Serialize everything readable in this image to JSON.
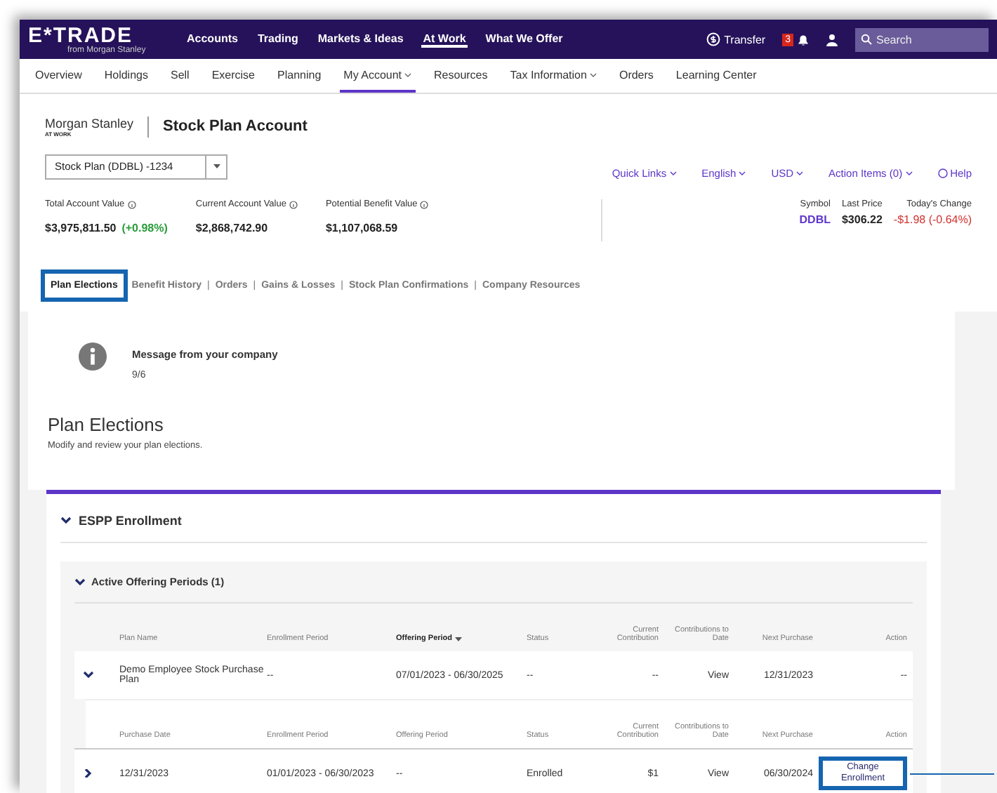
{
  "brand": {
    "logo": "E*TRADE",
    "tagline": "from Morgan Stanley"
  },
  "top_nav": [
    {
      "label": "Accounts",
      "selected": false
    },
    {
      "label": "Trading",
      "selected": false
    },
    {
      "label": "Markets & Ideas",
      "selected": false
    },
    {
      "label": "At Work",
      "selected": true
    },
    {
      "label": "What We Offer",
      "selected": false
    }
  ],
  "tab_separator": "|",
  "top_actions": {
    "transfer": "Transfer",
    "notifications": "3",
    "search": {
      "placeholder": "Search"
    }
  },
  "sub_nav": [
    {
      "label": "Overview",
      "selected": false,
      "dropdown": false
    },
    {
      "label": "Holdings",
      "selected": false,
      "dropdown": false
    },
    {
      "label": "Sell",
      "selected": false,
      "dropdown": false
    },
    {
      "label": "Exercise",
      "selected": false,
      "dropdown": false
    },
    {
      "label": "Planning",
      "selected": false,
      "dropdown": false
    },
    {
      "label": "My Account",
      "selected": true,
      "dropdown": true
    },
    {
      "label": "Resources",
      "selected": false,
      "dropdown": false
    },
    {
      "label": "Tax Information",
      "selected": false,
      "dropdown": true
    },
    {
      "label": "Orders",
      "selected": false,
      "dropdown": false
    },
    {
      "label": "Learning Center",
      "selected": false,
      "dropdown": false
    }
  ],
  "account_header": {
    "company_logo": "Morgan Stanley",
    "company_logo_sub": "AT WORK",
    "title": "Stock Plan Account",
    "account_select": "Stock Plan (DDBL) -1234",
    "links": [
      {
        "label": "Quick Links",
        "dropdown": true
      },
      {
        "label": "English",
        "dropdown": true
      },
      {
        "label": "USD",
        "dropdown": true
      },
      {
        "label": "Action Items (0)",
        "dropdown": true
      },
      {
        "label": "Help",
        "dropdown": false
      }
    ]
  },
  "values": [
    {
      "label": "Total Account Value",
      "value": "$3,975,811.50",
      "change": "(+0.98%)"
    },
    {
      "label": "Current Account Value",
      "value": "$2,868,742.90"
    },
    {
      "label": "Potential Benefit Value",
      "value": "$1,107,068.59"
    }
  ],
  "quote": {
    "symbol_label": "Symbol",
    "symbol": "DDBL",
    "last_price_label": "Last Price",
    "last_price": "$306.22",
    "change_label": "Today's Change",
    "change": "-$1.98 (-0.64%)"
  },
  "tabs": [
    {
      "label": "Plan Elections",
      "selected": true,
      "highlighted": true
    },
    {
      "label": "Benefit History",
      "selected": false,
      "highlighted": false
    },
    {
      "label": "Orders",
      "selected": false,
      "highlighted": false
    },
    {
      "label": "Gains & Losses",
      "selected": false,
      "highlighted": false
    },
    {
      "label": "Stock Plan Confirmations",
      "selected": false,
      "highlighted": false
    },
    {
      "label": "Company Resources",
      "selected": false,
      "highlighted": false
    }
  ],
  "message": {
    "title": "Message from your company",
    "body": "9/6"
  },
  "section": {
    "title": "Plan Elections",
    "subtitle": "Modify and review your plan elections."
  },
  "enrollment": {
    "title": "ESPP Enrollment",
    "expanded": true,
    "group": {
      "title": "Active Offering Periods (1)",
      "expanded": true,
      "columns": [
        {
          "label": "Plan Name",
          "sorted": false
        },
        {
          "label": "Enrollment Period",
          "sorted": false
        },
        {
          "label": "Offering Period",
          "sorted": true
        },
        {
          "label": "Status",
          "sorted": false
        },
        {
          "label": "Current Contribution",
          "sorted": false
        },
        {
          "label": "Contributions to Date",
          "sorted": false
        },
        {
          "label": "Next Purchase",
          "sorted": false
        },
        {
          "label": "Action",
          "sorted": false
        }
      ],
      "plan_row": {
        "expanded": true,
        "cells": [
          "Demo Employee Stock Purchase Plan",
          "--",
          "07/01/2023 - 06/30/2025",
          "--",
          "--",
          "View",
          "12/31/2023",
          "--"
        ]
      },
      "sub_columns": [
        "Purchase Date",
        "Enrollment Period",
        "Offering Period",
        "Status",
        "Current Contribution",
        "Contributions to Date",
        "Next Purchase",
        "Action"
      ],
      "sub_row": {
        "expanded": false,
        "cells": [
          "12/31/2023",
          "01/01/2023 - 06/30/2023",
          "--",
          "Enrolled",
          "$1",
          "View",
          "06/30/2024"
        ],
        "action": {
          "label": "Change Enrollment",
          "highlighted": true
        }
      }
    }
  }
}
